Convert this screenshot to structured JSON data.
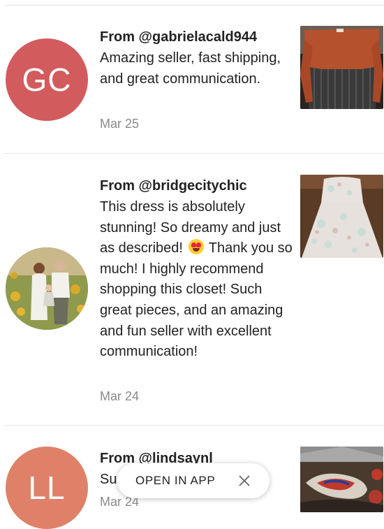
{
  "reviews": [
    {
      "from": "From @gabrielacald944",
      "initials": "GC",
      "avatar_color": "#d25b5e",
      "text": "Amazing seller, fast shipping, and great communication.",
      "date": "Mar 25",
      "thumbnail": "orange-top-photo"
    },
    {
      "from": "From @bridgecitychic",
      "text_before_emoji": "This dress is absolutely stunning! So dreamy and just as described!",
      "emoji": "heart-eyes-emoji",
      "text_after_emoji": "Thank you so much! I highly recommend shopping this closet! Such great pieces, and an amazing and fun seller with excellent communication!",
      "date": "Mar 24",
      "thumbnail": "floral-dress-photo"
    },
    {
      "from": "From @lindsaynl",
      "initials": "LL",
      "avatar_color": "#de8168",
      "text_partial": "Su",
      "date": "Mar 24",
      "thumbnail": "beaded-item-photo"
    }
  ],
  "app_banner": {
    "label": "OPEN IN APP",
    "close_icon": "close-icon"
  }
}
